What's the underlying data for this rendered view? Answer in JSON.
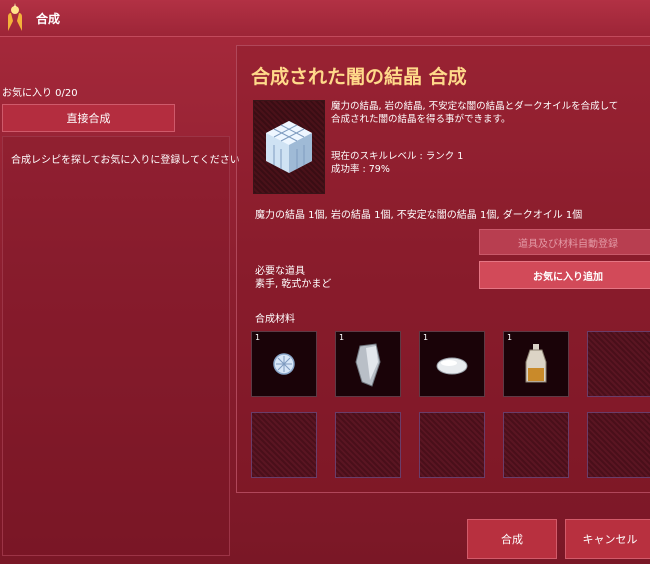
{
  "window": {
    "title": "合成",
    "icon": "synthesis-hands-icon"
  },
  "favorites": {
    "count_label": "お気に入り 0/20",
    "direct_button": "直接合成",
    "hint": "合成レシピを探してお気に入りに登録してください"
  },
  "recipe": {
    "title": "合成された闇の結晶 合成",
    "result_icon": "dark-crystal-cube-icon",
    "description_line1": "魔力の結晶, 岩の結晶, 不安定な闇の結晶とダークオイルを合成して",
    "description_line2": "合成された闇の結晶を得る事ができます。",
    "skill_level": "現在のスキルレベル : ランク 1",
    "success_rate": "成功率 : 79%",
    "materials_summary": "魔力の結晶 1個, 岩の結晶 1個, 不安定な闇の結晶 1個, ダークオイル 1個",
    "auto_register_button": "道具及び材料自動登録",
    "add_favorite_button": "お気に入り追加",
    "tools_label": "必要な道具",
    "tools_value": "素手, 乾式かまど",
    "materials_label": "合成材料",
    "materials": [
      {
        "qty": "1",
        "icon": "magic-crystal-icon"
      },
      {
        "qty": "1",
        "icon": "rock-crystal-icon"
      },
      {
        "qty": "1",
        "icon": "unstable-dark-crystal-icon"
      },
      {
        "qty": "1",
        "icon": "dark-oil-bottle-icon"
      }
    ]
  },
  "footer": {
    "synthesize_button": "合成",
    "cancel_button": "キャンセル"
  }
}
